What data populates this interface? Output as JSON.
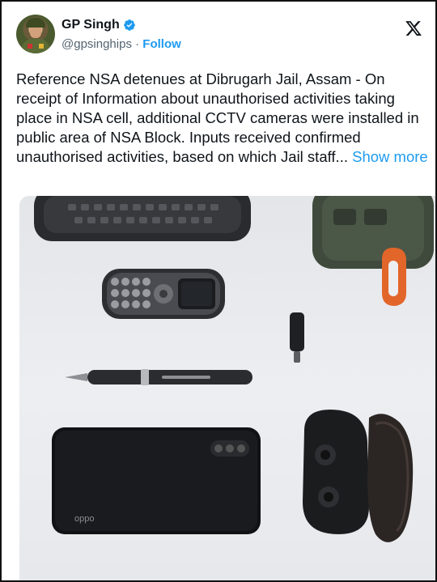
{
  "tweet": {
    "author_name": "GP Singh",
    "handle": "@gpsinghips",
    "separator": " · ",
    "follow_label": "Follow",
    "body_text": "Reference NSA detenues at Dibrugarh Jail, Assam - On receipt of Information about unauthorised activities taking place in NSA cell, additional CCTV cameras were installed in public area of NSA Block. Inputs received confirmed unauthorised activities, based on which Jail staff... ",
    "show_more_label": "Show more",
    "phone_brand_text": "oppo"
  },
  "colors": {
    "link_blue": "#1d9bf0",
    "handle_gray": "#536471",
    "text_dark": "#0f1419"
  },
  "icons": [
    "verified-badge-icon",
    "x-logo-icon"
  ]
}
